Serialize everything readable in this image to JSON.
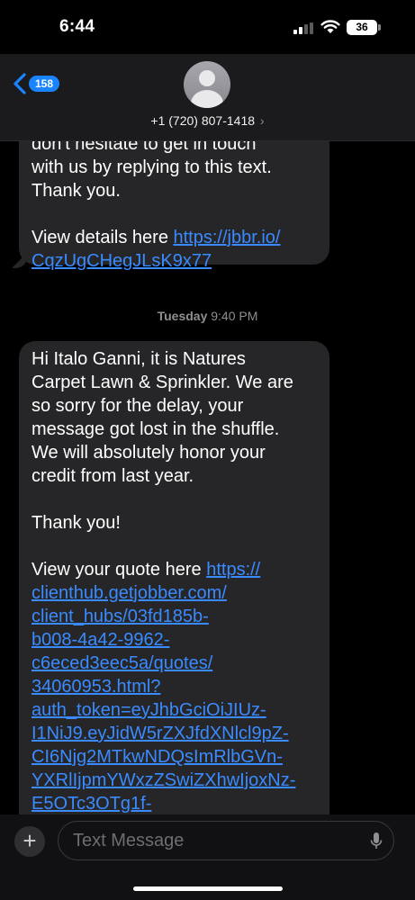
{
  "status_bar": {
    "time": "6:44",
    "battery": "36"
  },
  "header": {
    "back_count": "158",
    "contact": "+1 (720) 807-1418"
  },
  "messages": [
    {
      "text_lines": "don't hesitate to get in touch\nwith us by replying to this text.\nThank you.\n\nView details here ",
      "link": "https://jbbr.io/\nCqzUgCHegJLsK9x77"
    },
    {
      "text_lines": "Hi Italo Ganni, it is Natures\nCarpet Lawn & Sprinkler. We are\nso sorry for the delay, your\nmessage got lost in the shuffle.\nWe will absolutely honor your\ncredit from last year.\n\nThank you!\n\nView your quote here ",
      "link": "https://\nclienthub.getjobber.com/\nclient_hubs/03fd185b-\nb008-4a42-9962-\nc6eced3eec5a/quotes/\n34060953.html?\nauth_token=eyJhbGciOiJIUz-\nI1NiJ9.eyJidW5rZXJfdXNlcl9pZ-\nCI6Njg2MTkwNDQsImRlbGVn-\nYXRlIjpmYWxzZSwiZXhwIjoxNz-\nE5OTc3OTg1f-"
    }
  ],
  "timestamp": {
    "day": "Tuesday",
    "time": "9:40 PM"
  },
  "composer": {
    "placeholder": "Text Message"
  },
  "colors": {
    "bubble": "#262628",
    "link": "#3a8bff",
    "accent": "#1a84ff"
  }
}
